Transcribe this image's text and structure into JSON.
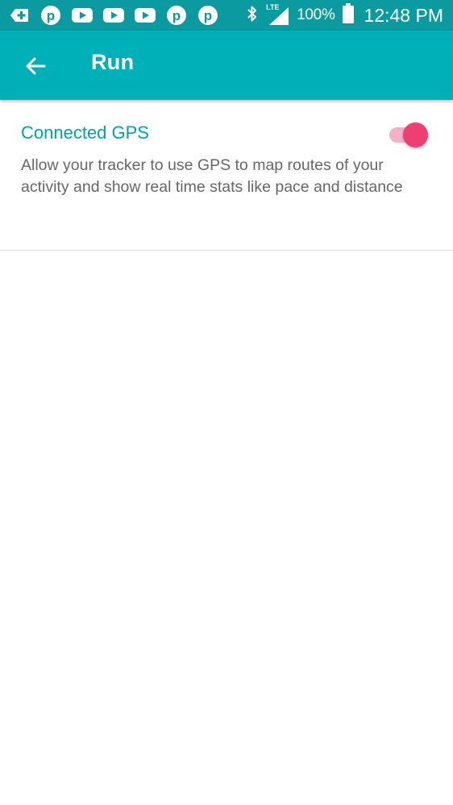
{
  "status_bar": {
    "notification_icons": [
      "plus-icon",
      "pinterest-icon",
      "youtube-icon",
      "youtube-icon",
      "youtube-icon",
      "pinterest-icon",
      "pinterest-icon"
    ],
    "network_label": "LTE",
    "battery_percent": "100%",
    "time": "12:48 PM"
  },
  "app_bar": {
    "title": "Run",
    "background_color": "#00b0b9"
  },
  "setting": {
    "title": "Connected GPS",
    "description": "Allow your tracker to use GPS to map routes of your activity and show real time stats like pace and distance",
    "enabled": true,
    "accent_color": "#ee3f73"
  }
}
